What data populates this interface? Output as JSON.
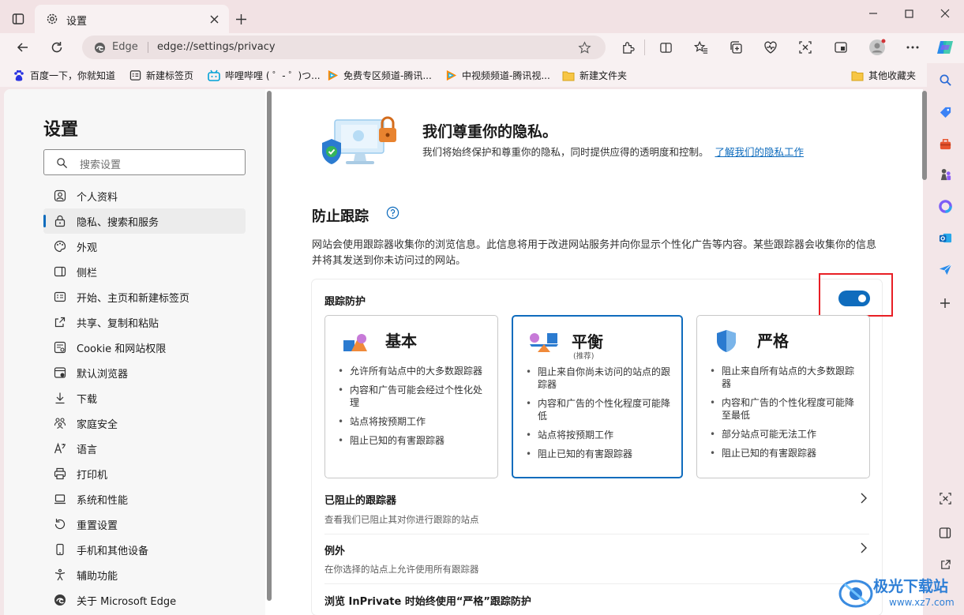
{
  "window": {
    "tab_title": "设置",
    "address_site": "Edge",
    "address_url": "edge://settings/privacy"
  },
  "favorites": [
    {
      "label": "百度一下，你就知道",
      "icon": "baidu-paw-icon"
    },
    {
      "label": "新建标签页",
      "icon": "new-tab-icon"
    },
    {
      "label": "哔哩哔哩 ( ゜- ゜)つ...",
      "icon": "bilibili-icon"
    },
    {
      "label": "免费专区频道-腾讯...",
      "icon": "tencent-video-icon"
    },
    {
      "label": "中视频频道-腾讯视...",
      "icon": "tencent-video-icon"
    },
    {
      "label": "新建文件夹",
      "icon": "folder-icon"
    },
    {
      "label": "其他收藏夹",
      "icon": "folder-icon"
    }
  ],
  "settings": {
    "title": "设置",
    "search_placeholder": "搜索设置",
    "nav": [
      {
        "label": "个人资料",
        "icon": "profile-icon"
      },
      {
        "label": "隐私、搜索和服务",
        "icon": "lock-icon",
        "active": true
      },
      {
        "label": "外观",
        "icon": "palette-icon"
      },
      {
        "label": "侧栏",
        "icon": "sidebar-icon"
      },
      {
        "label": "开始、主页和新建标签页",
        "icon": "home-icon"
      },
      {
        "label": "共享、复制和粘贴",
        "icon": "share-icon"
      },
      {
        "label": "Cookie 和网站权限",
        "icon": "cookie-icon"
      },
      {
        "label": "默认浏览器",
        "icon": "browser-icon"
      },
      {
        "label": "下载",
        "icon": "download-icon"
      },
      {
        "label": "家庭安全",
        "icon": "family-icon"
      },
      {
        "label": "语言",
        "icon": "language-icon"
      },
      {
        "label": "打印机",
        "icon": "printer-icon"
      },
      {
        "label": "系统和性能",
        "icon": "laptop-icon"
      },
      {
        "label": "重置设置",
        "icon": "reset-icon"
      },
      {
        "label": "手机和其他设备",
        "icon": "phone-icon"
      },
      {
        "label": "辅助功能",
        "icon": "accessibility-icon"
      },
      {
        "label": "关于 Microsoft Edge",
        "icon": "edge-icon"
      }
    ]
  },
  "main": {
    "hero_title": "我们尊重你的隐私。",
    "hero_text": "我们将始终保护和尊重你的隐私，同时提供应得的透明度和控制。",
    "hero_link": "了解我们的隐私工作",
    "section_title": "防止跟踪",
    "section_desc": "网站会使用跟踪器收集你的浏览信息。此信息将用于改进网站服务并向你显示个性化广告等内容。某些跟踪器会收集你的信息并将其发送到你未访问过的网站。",
    "tracking_label": "跟踪防护",
    "tracking_enabled": true,
    "options": [
      {
        "name": "基本",
        "sub": "",
        "selected": false,
        "items": [
          "允许所有站点中的大多数跟踪器",
          "内容和广告可能会经过个性化处理",
          "站点将按预期工作",
          "阻止已知的有害跟踪器"
        ]
      },
      {
        "name": "平衡",
        "sub": "(推荐)",
        "selected": true,
        "items": [
          "阻止来自你尚未访问的站点的跟踪器",
          "内容和广告的个性化程度可能降低",
          "站点将按预期工作",
          "阻止已知的有害跟踪器"
        ]
      },
      {
        "name": "严格",
        "sub": "",
        "selected": false,
        "items": [
          "阻止来自所有站点的大多数跟踪器",
          "内容和广告的个性化程度可能降至最低",
          "部分站点可能无法工作",
          "阻止已知的有害跟踪器"
        ]
      }
    ],
    "blocked_title": "已阻止的跟踪器",
    "blocked_sub": "查看我们已阻止其对你进行跟踪的站点",
    "exceptions_title": "例外",
    "exceptions_sub": "在你选择的站点上允许使用所有跟踪器",
    "inprivate_title": "浏览 InPrivate 时始终使用“严格”跟踪防护"
  },
  "watermark": "极光下载站",
  "watermark_url": "www.xz7.com",
  "colors": {
    "accent": "#0f6cbd",
    "highlight": "#e81f25"
  }
}
